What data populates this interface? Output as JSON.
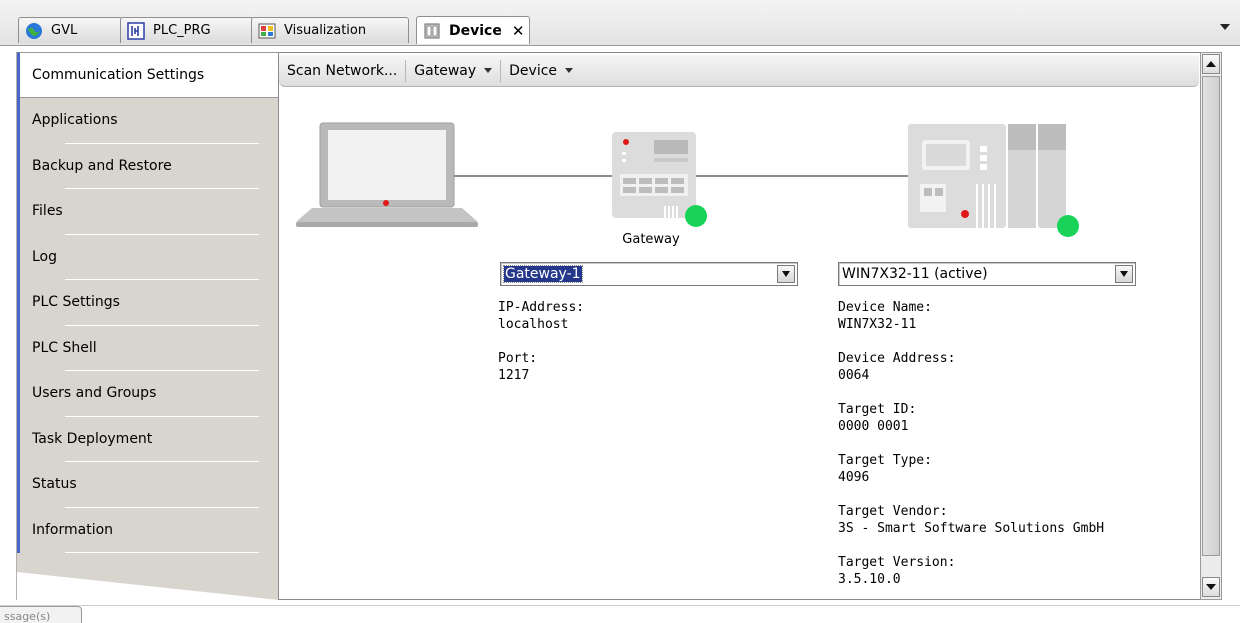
{
  "tabs": [
    {
      "label": "GVL",
      "icon": "globe-icon"
    },
    {
      "label": "PLC_PRG",
      "icon": "program-icon"
    },
    {
      "label": "Visualization",
      "icon": "visualization-icon"
    },
    {
      "label": "Device",
      "icon": "device-icon",
      "active": true,
      "close": "✕"
    }
  ],
  "nav": {
    "items": [
      "Communication Settings",
      "Applications",
      "Backup and Restore",
      "Files",
      "Log",
      "PLC Settings",
      "PLC Shell",
      "Users and Groups",
      "Task Deployment",
      "Status",
      "Information"
    ],
    "selected": "Communication Settings"
  },
  "toolbar": {
    "scan_label": "Scan Network...",
    "gateway_label": "Gateway",
    "device_label": "Device"
  },
  "gateway": {
    "caption": "Gateway",
    "selected": "Gateway-1",
    "ip_label": "IP-Address:",
    "ip_value": "localhost",
    "port_label": "Port:",
    "port_value": "1217",
    "status_color": "#19d25a"
  },
  "device": {
    "selected": "WIN7X32-11 (active)",
    "fields": [
      {
        "label": "Device Name:",
        "value": "WIN7X32-11"
      },
      {
        "label": "Device Address:",
        "value": "0064"
      },
      {
        "label": "Target ID:",
        "value": "0000  0001"
      },
      {
        "label": "Target Type:",
        "value": "4096"
      },
      {
        "label": "Target Vendor:",
        "value": "3S - Smart Software Solutions GmbH"
      },
      {
        "label": "Target Version:",
        "value": "3.5.10.0"
      }
    ],
    "status_color": "#19d25a"
  },
  "bottom_tab": "ssage(s)",
  "colors": {
    "nav_accent": "#4a66c9",
    "selection": "#24378a",
    "nav_bg": "#d8d4ce"
  }
}
